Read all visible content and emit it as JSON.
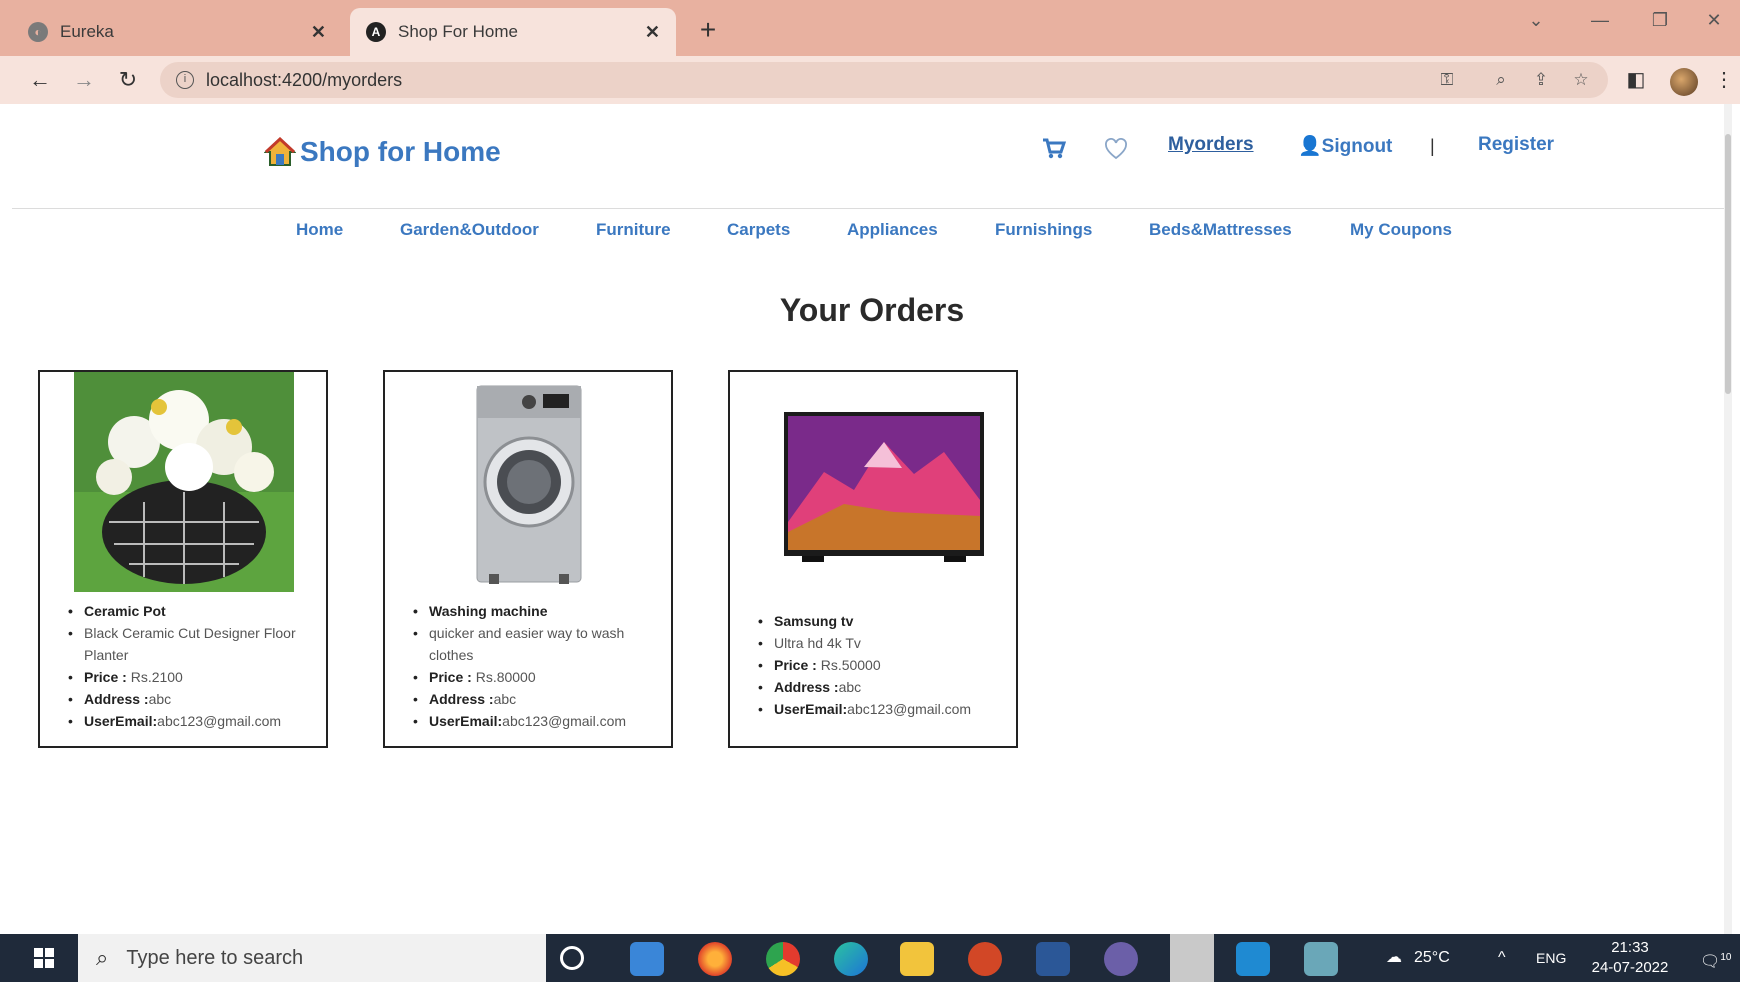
{
  "browser": {
    "tabs": [
      {
        "title": "Eureka",
        "active": false
      },
      {
        "title": "Shop For Home",
        "active": true
      }
    ],
    "url": "localhost:4200/myorders"
  },
  "header": {
    "brand": "Shop for Home",
    "links": [
      "Myorders",
      "Signout",
      "Register"
    ],
    "separator": "|"
  },
  "categories": [
    "Home",
    "Garden&Outdoor",
    "Furniture",
    "Carpets",
    "Appliances",
    "Furnishings",
    "Beds&Mattresses",
    "My Coupons"
  ],
  "page_title": "Your Orders",
  "orders": [
    {
      "name": "Ceramic Pot",
      "description": "Black Ceramic Cut Designer Floor Planter",
      "price_label": "Price :",
      "price": " Rs.2100",
      "address_label": "Address :",
      "address": "abc",
      "email_label": "UserEmail:",
      "email": "abc123@gmail.com"
    },
    {
      "name": "Washing machine",
      "description": "quicker and easier way to wash clothes",
      "price_label": "Price :",
      "price": " Rs.80000",
      "address_label": "Address :",
      "address": "abc",
      "email_label": "UserEmail:",
      "email": "abc123@gmail.com"
    },
    {
      "name": "Samsung tv",
      "description": "Ultra hd 4k Tv",
      "price_label": "Price :",
      "price": " Rs.50000",
      "address_label": "Address :",
      "address": "abc",
      "email_label": "UserEmail:",
      "email": "abc123@gmail.com"
    }
  ],
  "taskbar": {
    "search_placeholder": "Type here to search",
    "weather": "25°C",
    "lang": "ENG",
    "time": "21:33",
    "date": "24-07-2022",
    "notifications": "10"
  },
  "colors": {
    "link_blue": "#3b78c0",
    "tab_strip": "#e8b1a0",
    "toolbar": "#f7e3dc",
    "taskbar": "#1f2a3a"
  }
}
